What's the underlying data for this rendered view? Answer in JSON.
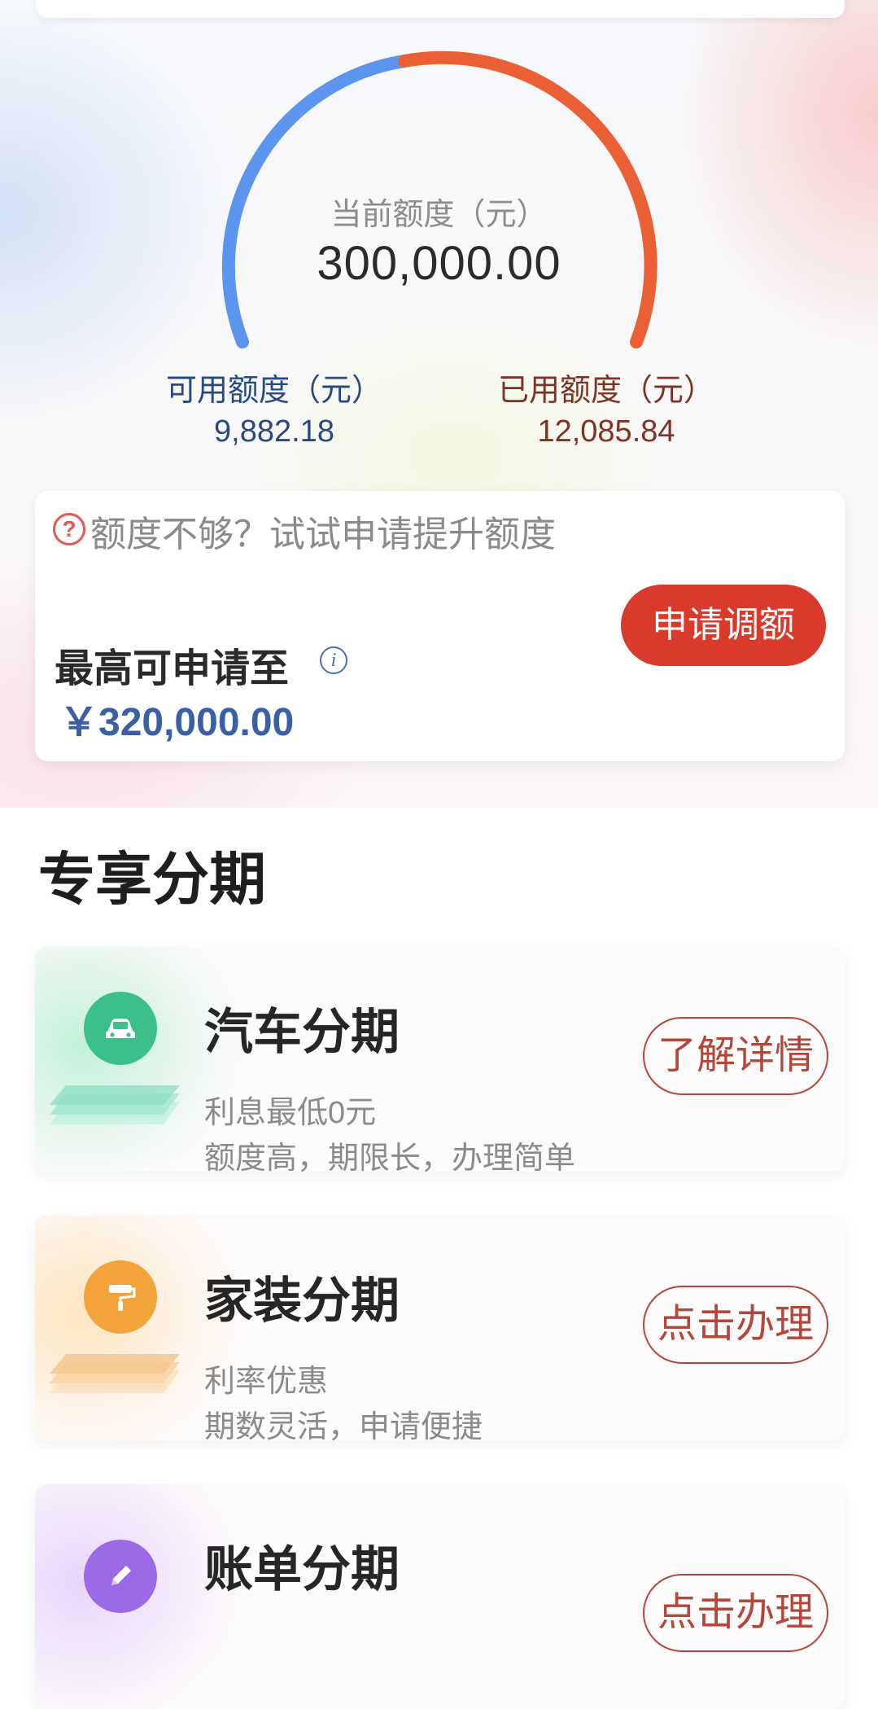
{
  "colors": {
    "gauge_available": "#5b95ef",
    "gauge_used": "#ea5f34",
    "primary_red": "#d93a2b",
    "amount_blue": "#3b5fa3"
  },
  "credit": {
    "current_label": "当前额度（元）",
    "current_value": "300,000.00",
    "available_label": "可用额度（元）",
    "available_value": "9,882.18",
    "used_label": "已用额度（元）",
    "used_value": "12,085.84",
    "gauge_used_fraction": 0.55
  },
  "raise": {
    "prompt": "额度不够？试试申请提升额度",
    "max_label": "最高可申请至",
    "max_amount": "￥320,000.00",
    "apply_button": "申请调额"
  },
  "section": {
    "title": "专享分期"
  },
  "products": [
    {
      "title": "汽车分期",
      "line1": "利息最低0元",
      "line2": "额度高，期限长，办理简单",
      "button": "了解详情",
      "icon": "car-icon",
      "color": "#3cc08a"
    },
    {
      "title": "家装分期",
      "line1": "利率优惠",
      "line2": "期数灵活，申请便捷",
      "button": "点击办理",
      "icon": "paint-roller-icon",
      "color": "#f2a33a"
    },
    {
      "title": "账单分期",
      "line1": "",
      "line2": "",
      "button": "点击办理",
      "icon": "pencil-icon",
      "color": "#9b6ae6"
    }
  ]
}
